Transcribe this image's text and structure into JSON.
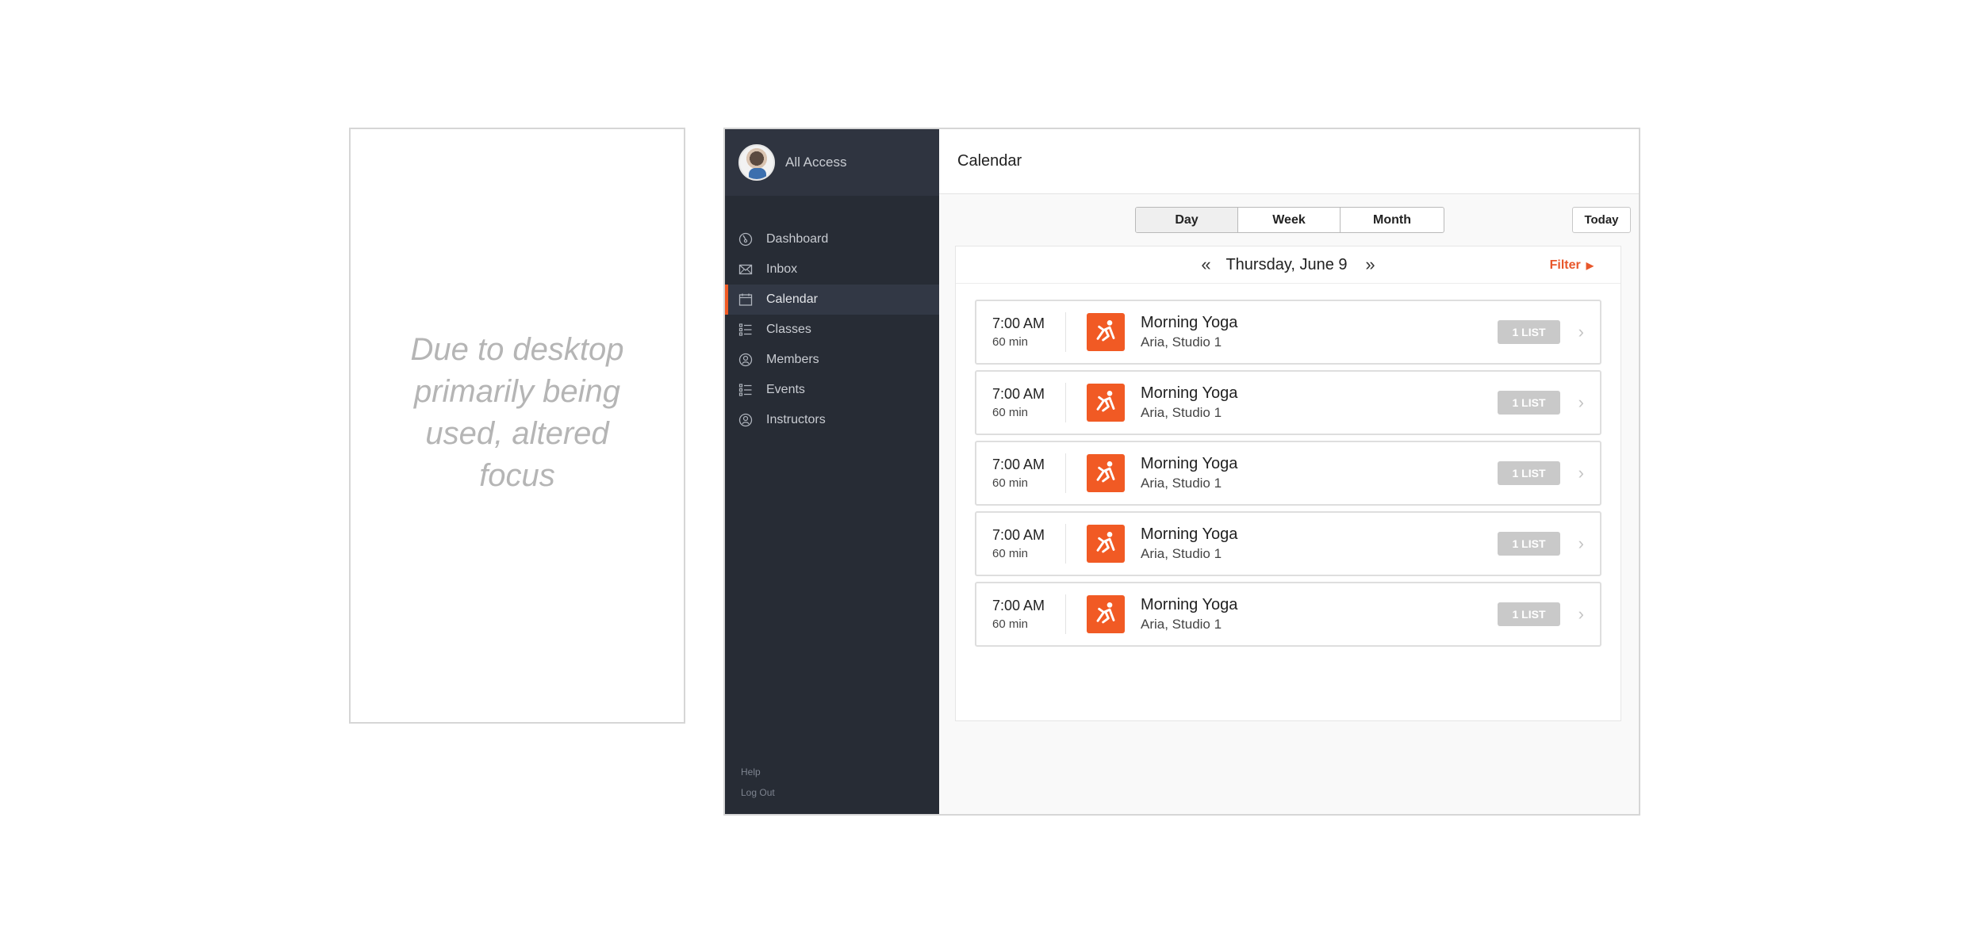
{
  "mobile_note": "Due to desktop primarily being used, altered focus",
  "sidebar": {
    "account": "All Access",
    "items": [
      {
        "label": "Dashboard",
        "icon": "dashboard-icon"
      },
      {
        "label": "Inbox",
        "icon": "inbox-icon"
      },
      {
        "label": "Calendar",
        "icon": "calendar-icon",
        "active": true
      },
      {
        "label": "Classes",
        "icon": "list-icon"
      },
      {
        "label": "Members",
        "icon": "person-icon"
      },
      {
        "label": "Events",
        "icon": "list-icon"
      },
      {
        "label": "Instructors",
        "icon": "person-icon"
      }
    ],
    "footer": {
      "help": "Help",
      "logout": "Log Out"
    }
  },
  "header": {
    "title": "Calendar"
  },
  "view_toggle": {
    "day": "Day",
    "week": "Week",
    "month": "Month",
    "selected": "Day"
  },
  "today_label": "Today",
  "calendar": {
    "prev_icon": "double-chevron-left-icon",
    "next_icon": "double-chevron-right-icon",
    "date": "Thursday, June 9",
    "filter_label": "Filter",
    "classes": [
      {
        "time": "7:00 AM",
        "duration": "60 min",
        "name": "Morning Yoga",
        "location": "Aria, Studio 1",
        "badge": "1 LIST"
      },
      {
        "time": "7:00 AM",
        "duration": "60 min",
        "name": "Morning Yoga",
        "location": "Aria, Studio 1",
        "badge": "1 LIST"
      },
      {
        "time": "7:00 AM",
        "duration": "60 min",
        "name": "Morning Yoga",
        "location": "Aria, Studio 1",
        "badge": "1 LIST"
      },
      {
        "time": "7:00 AM",
        "duration": "60 min",
        "name": "Morning Yoga",
        "location": "Aria, Studio 1",
        "badge": "1 LIST"
      },
      {
        "time": "7:00 AM",
        "duration": "60 min",
        "name": "Morning Yoga",
        "location": "Aria, Studio 1",
        "badge": "1 LIST"
      }
    ]
  },
  "colors": {
    "accent": "#f15a24",
    "sidebar_bg": "#272c35",
    "badge_bg": "#c9c9c9"
  }
}
